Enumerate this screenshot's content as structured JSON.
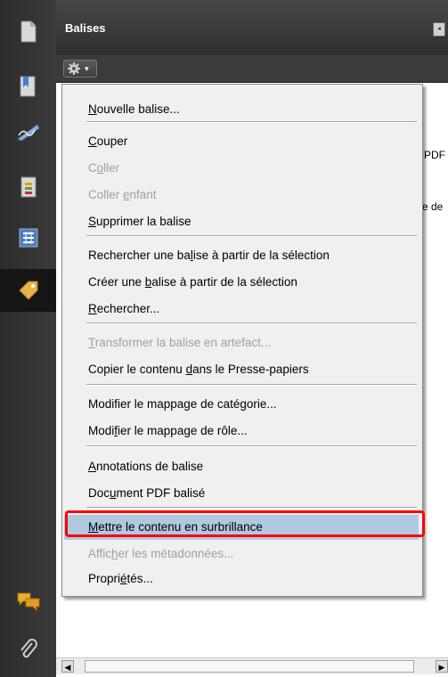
{
  "panel": {
    "title": "Balises"
  },
  "background_text": {
    "line1": "PDF",
    "line2": "e de"
  },
  "sidebar": {
    "icons": [
      "pages-icon",
      "bookmarks-icon",
      "signatures-icon",
      "layers-icon",
      "model-tree-icon",
      "tags-icon",
      "comments-icon",
      "attachments-icon"
    ]
  },
  "menu": {
    "items": [
      {
        "pre": "",
        "key": "N",
        "post": "ouvelle balise...",
        "disabled": false
      },
      {
        "pre": "",
        "key": "C",
        "post": "ouper",
        "disabled": false
      },
      {
        "pre": "C",
        "key": "o",
        "post": "ller",
        "disabled": true
      },
      {
        "pre": "Coller ",
        "key": "e",
        "post": "nfant",
        "disabled": true
      },
      {
        "pre": "",
        "key": "S",
        "post": "upprimer la balise",
        "disabled": false
      },
      {
        "pre": "Rechercher une ba",
        "key": "l",
        "post": "ise à partir de la sélection",
        "disabled": false
      },
      {
        "pre": "Créer une ",
        "key": "b",
        "post": "alise à partir de la sélection",
        "disabled": false
      },
      {
        "pre": "",
        "key": "R",
        "post": "echercher...",
        "disabled": false
      },
      {
        "pre": "",
        "key": "T",
        "post": "ransformer la balise en artefact...",
        "disabled": true
      },
      {
        "pre": "Copier le contenu ",
        "key": "d",
        "post": "ans le Presse-papiers",
        "disabled": false
      },
      {
        "pre": "Modifier le mappage de caté",
        "key": "g",
        "post": "orie...",
        "disabled": false
      },
      {
        "pre": "Modi",
        "key": "f",
        "post": "ier le mappage de rôle...",
        "disabled": false
      },
      {
        "pre": "",
        "key": "A",
        "post": "nnotations de balise",
        "disabled": false
      },
      {
        "pre": "Doc",
        "key": "u",
        "post": "ment PDF balisé",
        "disabled": false
      },
      {
        "pre": "",
        "key": "M",
        "post": "ettre le contenu en surbrillance",
        "disabled": false
      },
      {
        "pre": "Affic",
        "key": "h",
        "post": "er les métadonnées...",
        "disabled": true
      },
      {
        "pre": "Propri",
        "key": "é",
        "post": "tés...",
        "disabled": false
      }
    ]
  },
  "colors": {
    "highlight": "#aec9e0",
    "callout": "#ff0000",
    "disabled_text": "#a0a0a0"
  }
}
